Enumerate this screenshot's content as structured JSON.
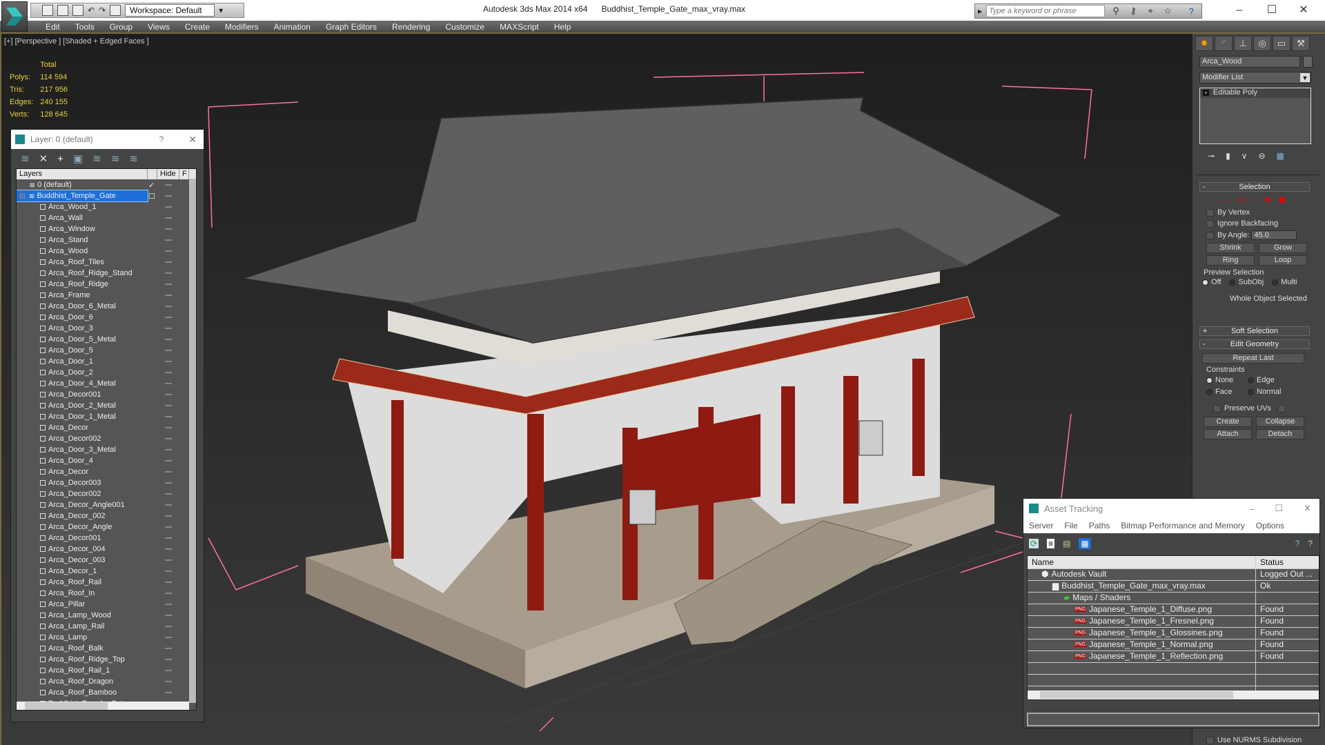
{
  "app": {
    "title": "Autodesk 3ds Max 2014 x64",
    "file": "Buddhist_Temple_Gate_max_vray.max",
    "workspace": "Workspace: Default",
    "search_placeholder": "Type a keyword or phrase"
  },
  "menu": [
    "Edit",
    "Tools",
    "Group",
    "Views",
    "Create",
    "Modifiers",
    "Animation",
    "Graph Editors",
    "Rendering",
    "Customize",
    "MAXScript",
    "Help"
  ],
  "viewport": {
    "label": "[+] [Perspective ] [Shaded + Edged Faces ]",
    "stats": {
      "header": "Total",
      "rows": [
        {
          "k": "Polys:",
          "v": "114 594"
        },
        {
          "k": "Tris:",
          "v": "217 956"
        },
        {
          "k": "Edges:",
          "v": "240 155"
        },
        {
          "k": "Verts:",
          "v": "128 645"
        }
      ]
    }
  },
  "layer_window": {
    "title": "Layer: 0 (default)",
    "help": "?",
    "col_layers": "Layers",
    "col_hide": "Hide",
    "col_f": "F",
    "layers": [
      {
        "name": "0 (default)",
        "level": 0,
        "active": true
      },
      {
        "name": "Buddhist_Temple_Gate",
        "level": 0,
        "selected": true
      }
    ],
    "objects": [
      "Arca_Wood_1",
      "Arca_Wall",
      "Arca_Window",
      "Arca_Stand",
      "Arca_Wood",
      "Arca_Roof_Tiles",
      "Arca_Roof_Ridge_Stand",
      "Arca_Roof_Ridge",
      "Arca_Frame",
      "Arca_Door_6_Metal",
      "Arca_Door_6",
      "Arca_Door_3",
      "Arca_Door_5_Metal",
      "Arca_Door_5",
      "Arca_Door_1",
      "Arca_Door_2",
      "Arca_Door_4_Metal",
      "Arca_Decor001",
      "Arca_Door_2_Metal",
      "Arca_Door_1_Metal",
      "Arca_Decor",
      "Arca_Decor002",
      "Arca_Door_3_Metal",
      "Arca_Door_4",
      "Arca_Decor",
      "Arca_Decor003",
      "Arca_Decor002",
      "Arca_Decor_Angle001",
      "Arca_Decor_002",
      "Arca_Decor_Angle",
      "Arca_Decor001",
      "Arca_Decor_004",
      "Arca_Decor_003",
      "Arca_Decor_1",
      "Arca_Roof_Rail",
      "Arca_Roof_In",
      "Arca_Pillar",
      "Arca_Lamp_Wood",
      "Arca_Lamp_Rail",
      "Arca_Lamp",
      "Arca_Roof_Balk",
      "Arca_Roof_Ridge_Top",
      "Arca_Roof_Rail_1",
      "Arca_Roof_Dragon",
      "Arca_Roof_Bamboo",
      "Buddhist_Temple_Gate"
    ]
  },
  "command_panel": {
    "object_name": "Arca_Wood",
    "modifier_list": "Modifier List",
    "stack": [
      "Editable Poly"
    ],
    "selection": {
      "title": "Selection",
      "by_vertex": "By Vertex",
      "ignore_backfacing": "Ignore Backfacing",
      "by_angle": "By Angle:",
      "angle": "45.0",
      "shrink": "Shrink",
      "grow": "Grow",
      "ring": "Ring",
      "loop": "Loop",
      "preview": "Preview Selection",
      "off": "Off",
      "subobj": "SubObj",
      "multi": "Multi",
      "status": "Whole Object Selected"
    },
    "soft_selection": "Soft Selection",
    "edit_geometry": {
      "title": "Edit Geometry",
      "repeat_last": "Repeat Last",
      "constraints": "Constraints",
      "none": "None",
      "edge": "Edge",
      "face": "Face",
      "normal": "Normal",
      "preserve_uvs": "Preserve UVs",
      "create": "Create",
      "collapse": "Collapse",
      "attach": "Attach",
      "detach": "Detach"
    },
    "nurms": "Use NURMS Subdivision"
  },
  "asset_tracking": {
    "title": "Asset Tracking",
    "menu": [
      "Server",
      "File",
      "Paths",
      "Bitmap Performance and Memory",
      "Options"
    ],
    "col_name": "Name",
    "col_status": "Status",
    "rows": [
      {
        "name": "Autodesk Vault",
        "status": "Logged Out ...",
        "level": 0,
        "icon": "vault"
      },
      {
        "name": "Buddhist_Temple_Gate_max_vray.max",
        "status": "Ok",
        "level": 1,
        "icon": "max"
      },
      {
        "name": "Maps / Shaders",
        "status": "",
        "level": 2,
        "icon": "maps"
      },
      {
        "name": "Japanese_Temple_1_Diffuse.png",
        "status": "Found",
        "level": 3,
        "icon": "png"
      },
      {
        "name": "Japanese_Temple_1_Fresnel.png",
        "status": "Found",
        "level": 3,
        "icon": "png"
      },
      {
        "name": "Japanese_Temple_1_Glossines.png",
        "status": "Found",
        "level": 3,
        "icon": "png"
      },
      {
        "name": "Japanese_Temple_1_Normal.png",
        "status": "Found",
        "level": 3,
        "icon": "png"
      },
      {
        "name": "Japanese_Temple_1_Reflection.png",
        "status": "Found",
        "level": 3,
        "icon": "png"
      }
    ]
  },
  "colors": {
    "accent": "#1e6fd9",
    "stats": "#e8d23a",
    "selection_box": "#ff6fa8",
    "pillar": "#8e1a12"
  }
}
